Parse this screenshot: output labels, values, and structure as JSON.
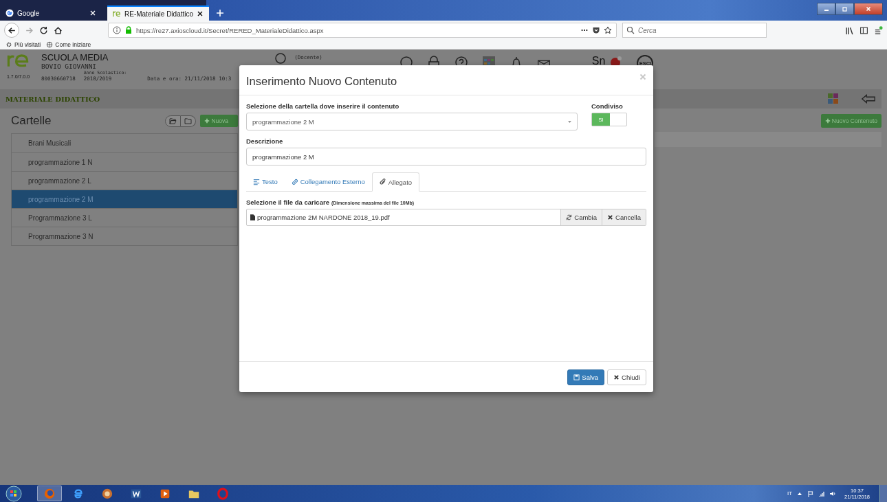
{
  "browser": {
    "tabs": [
      {
        "title": "Google",
        "selected": false
      },
      {
        "title": "RE-Materiale Didattico",
        "selected": true
      }
    ],
    "url": "https://re27.axioscloud.it/Secret/RERED_MaterialeDidattico.aspx",
    "search_placeholder": "Cerca",
    "bookmarks": [
      "Più visitati",
      "Come iniziare"
    ]
  },
  "header": {
    "school": "SCUOLA MEDIA",
    "teacher": "BOVIO GIOVANNI",
    "version": "1.7.0/7.0.0",
    "code": "80030660718",
    "year_label": "Anno Scolastico:",
    "year": "2018/2019",
    "datetime": "Data e ora: 21/11/2018 10:3",
    "role": "(Docente)",
    "sn_label": "Sn",
    "exit_label": "ESCI"
  },
  "section_title": "MATERIALE DIDATTICO",
  "folders": {
    "title": "Cartelle",
    "new_button": "Nuova",
    "items": [
      {
        "name": "Brani Musicali",
        "selected": false
      },
      {
        "name": "programmazione 1 N",
        "selected": false
      },
      {
        "name": "programmazione 2 L",
        "selected": false
      },
      {
        "name": "programmazione 2 M",
        "selected": true
      },
      {
        "name": "Programmazione 3 L",
        "selected": false
      },
      {
        "name": "Programmazione 3 N",
        "selected": false
      }
    ]
  },
  "new_content_button": "Nuovo Contenuto",
  "modal": {
    "title": "Inserimento Nuovo Contenuto",
    "folder_label": "Selezione della cartella dove inserire il contenuto",
    "folder_value": "programmazione 2 M",
    "shared_label": "Condiviso",
    "shared_on": true,
    "shared_text": "SI",
    "description_label": "Descrizione",
    "description_value": "programmazione 2 M",
    "tabs": [
      {
        "label": "Testo",
        "kind": "text",
        "selected": false
      },
      {
        "label": "Collegamento Esterno",
        "kind": "link",
        "selected": false
      },
      {
        "label": "Allegato",
        "kind": "attachment",
        "selected": true
      }
    ],
    "file_label": "Selezione il file da caricare",
    "file_hint": "(Dimensione massima del file 10Mb)",
    "file_name": "programmazione 2M NARDONE 2018_19.pdf",
    "change_button": "Cambia",
    "clear_button": "Cancella",
    "save_button": "Salva",
    "close_button": "Chiudi"
  },
  "taskbar": {
    "language": "IT",
    "time": "10:37",
    "date": "21/11/2018"
  }
}
